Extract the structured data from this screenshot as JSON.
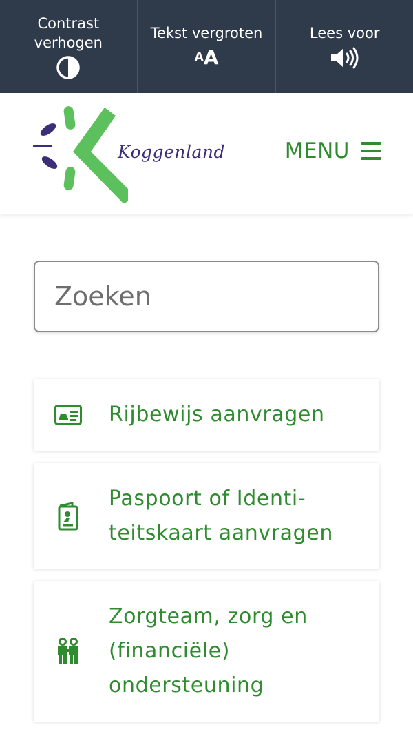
{
  "accessibility_bar": {
    "contrast_label": "Contrast\nverhogen",
    "text_size_label": "Tekst vergroten",
    "text_size_small_glyph": "A",
    "text_size_big_glyph": "A",
    "read_aloud_label": "Lees voor",
    "icons": [
      "contrast-icon",
      "text-size-icon",
      "speaker-icon"
    ]
  },
  "header": {
    "logo_text": "Koggenland",
    "menu_label": "MENU",
    "menu_icon": "hamburger-icon"
  },
  "search": {
    "placeholder": "Zoeken",
    "value": "",
    "button_icon": "search-icon"
  },
  "tasks": [
    {
      "label": "Rijbewijs aanvragen",
      "icon": "drivers-license-icon"
    },
    {
      "label": "Paspoort of Identi-\nteitskaart aanvragen",
      "icon": "passport-icon"
    },
    {
      "label": "Zorgteam, zorg en\n(financiële)\nondersteuning",
      "icon": "care-people-icon"
    }
  ],
  "colors": {
    "toolbar_bg": "#2f3a4b",
    "brand_green": "#2e8b2e",
    "brand_purple": "#3d2e7a",
    "search_button": "#263089",
    "logo_green": "#5cc05c"
  }
}
